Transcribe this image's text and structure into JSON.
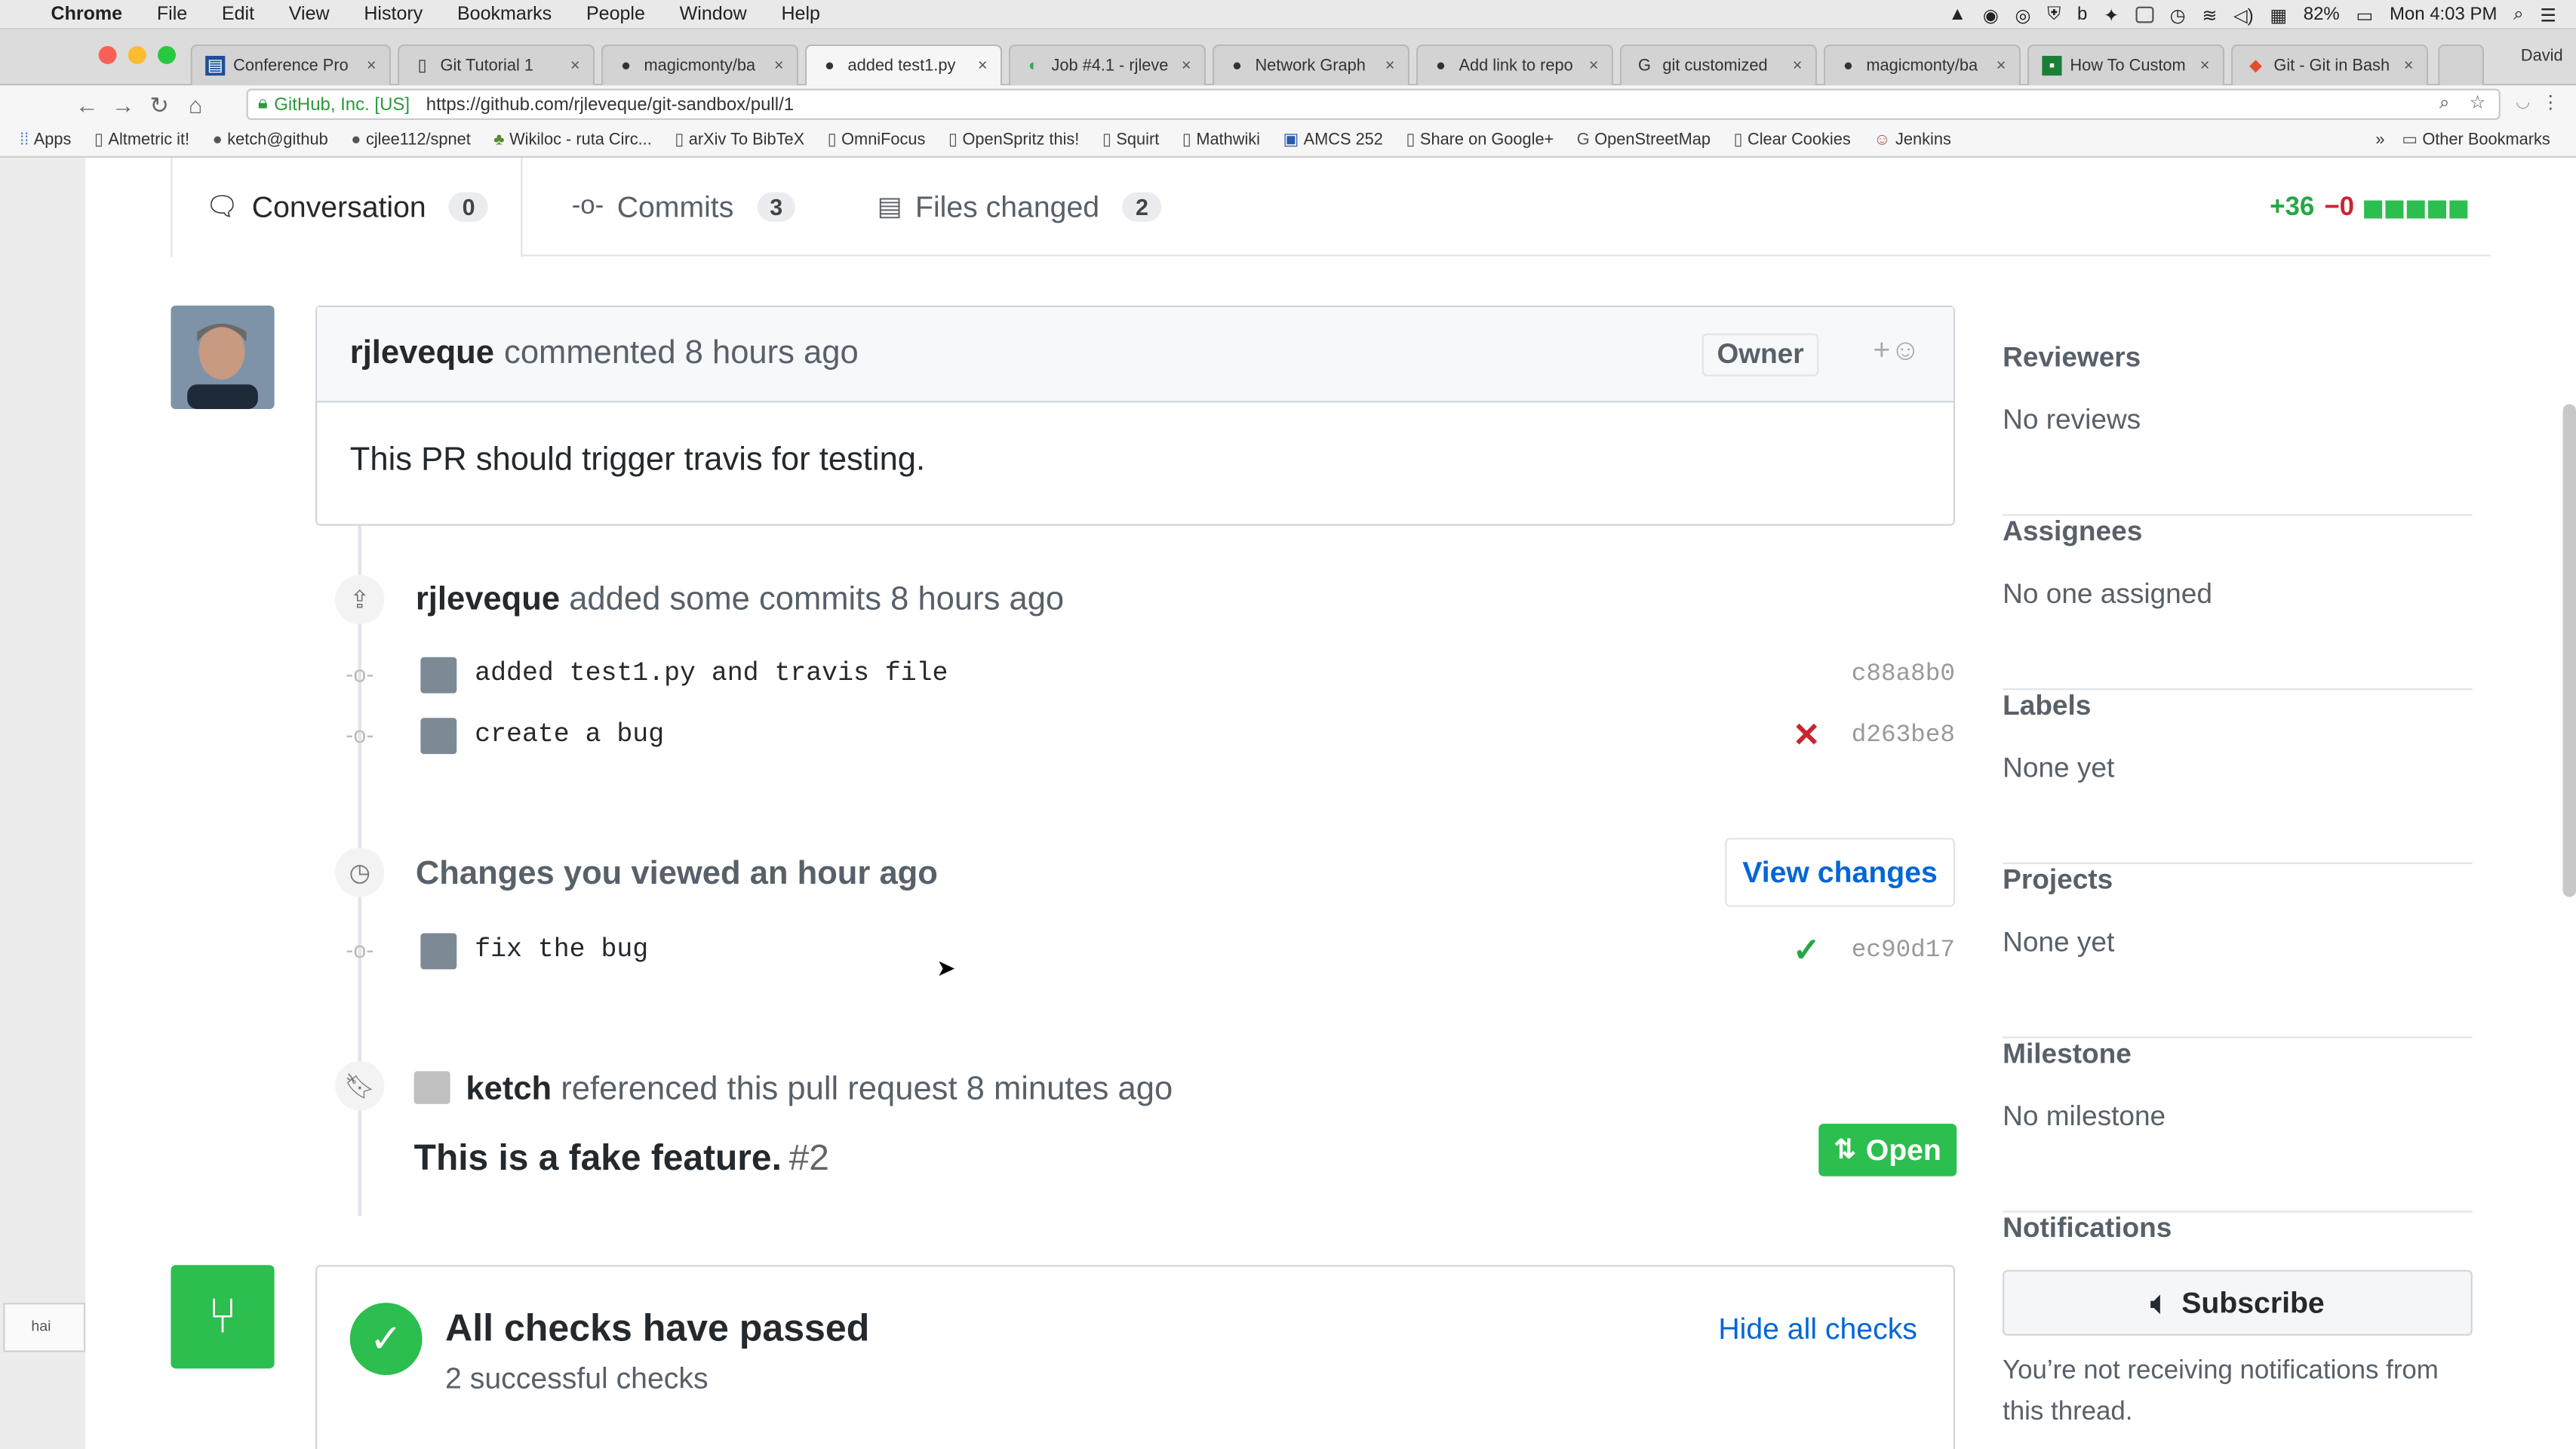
{
  "menubar": {
    "app": "Chrome",
    "items": [
      "File",
      "Edit",
      "View",
      "History",
      "Bookmarks",
      "People",
      "Window",
      "Help"
    ],
    "battery": "82%",
    "clock": "Mon 4:03 PM"
  },
  "tabs": [
    {
      "title": "Conference Pro",
      "icon": "conference-icon"
    },
    {
      "title": "Git Tutorial 1",
      "icon": "doc-icon"
    },
    {
      "title": "magicmonty/ba",
      "icon": "github-icon"
    },
    {
      "title": "added test1.py",
      "icon": "github-icon"
    },
    {
      "title": "Job #4.1 - rjleve",
      "icon": "travis-icon"
    },
    {
      "title": "Network Graph",
      "icon": "github-icon"
    },
    {
      "title": "Add link to repo",
      "icon": "github-icon"
    },
    {
      "title": "git customized",
      "icon": "google-icon"
    },
    {
      "title": "magicmonty/ba",
      "icon": "github-icon"
    },
    {
      "title": "How To Custom",
      "icon": "bookmark-icon"
    },
    {
      "title": "Git - Git in Bash",
      "icon": "git-icon"
    }
  ],
  "profile_name": "David",
  "address": {
    "secure_label": "GitHub, Inc. [US]",
    "url": "https://github.com/rjleveque/git-sandbox/pull/1"
  },
  "bookmarks": {
    "items": [
      "Apps",
      "Altmetric it!",
      "ketch@github",
      "cjlee112/spnet",
      "Wikiloc - ruta Circ...",
      "arXiv To BibTeX",
      "OmniFocus",
      "OpenSpritz this!",
      "Squirt",
      "Mathwiki",
      "AMCS 252",
      "Share on Google+",
      "OpenStreetMap",
      "Clear Cookies",
      "Jenkins"
    ],
    "overflow": "»",
    "other": "Other Bookmarks"
  },
  "left_strip_text": "hai",
  "pr_tabs": {
    "conversation": {
      "label": "Conversation",
      "count": "0"
    },
    "commits": {
      "label": "Commits",
      "count": "3"
    },
    "files": {
      "label": "Files changed",
      "count": "2"
    }
  },
  "diffstat": {
    "added": "+36",
    "removed": "−0"
  },
  "comment": {
    "author": "rjleveque",
    "action": "commented 8 hours ago",
    "role": "Owner",
    "body": "This PR should trigger travis for testing."
  },
  "commits_event": {
    "author": "rjleveque",
    "action": "added some commits 8 hours ago",
    "commits": [
      {
        "message": "added test1.py and travis file",
        "sha": "c88a8b0",
        "status": ""
      },
      {
        "message": "create a bug",
        "sha": "d263be8",
        "status": "✕"
      }
    ]
  },
  "viewed_event": {
    "text": "Changes you viewed an hour ago",
    "button": "View changes",
    "commits": [
      {
        "message": "fix the bug",
        "sha": "ec90d17",
        "status": "✓"
      }
    ]
  },
  "reference_event": {
    "author": "ketch",
    "action": "referenced this pull request 8 minutes ago",
    "title": "This is a fake feature.",
    "number": "#2",
    "state": "Open"
  },
  "checks": {
    "heading": "All checks have passed",
    "sub": "2 successful checks",
    "toggle": "Hide all checks"
  },
  "sidebar": {
    "reviewers": {
      "label": "Reviewers",
      "value": "No reviews"
    },
    "assignees": {
      "label": "Assignees",
      "value": "No one assigned"
    },
    "labels": {
      "label": "Labels",
      "value": "None yet"
    },
    "projects": {
      "label": "Projects",
      "value": "None yet"
    },
    "milestone": {
      "label": "Milestone",
      "value": "No milestone"
    },
    "notifications": {
      "label": "Notifications",
      "button": "Subscribe",
      "note": "You’re not receiving notifications from this thread."
    }
  },
  "colors": {
    "green": "#2cbe4e",
    "link": "#0366d6",
    "red": "#cb2431"
  }
}
